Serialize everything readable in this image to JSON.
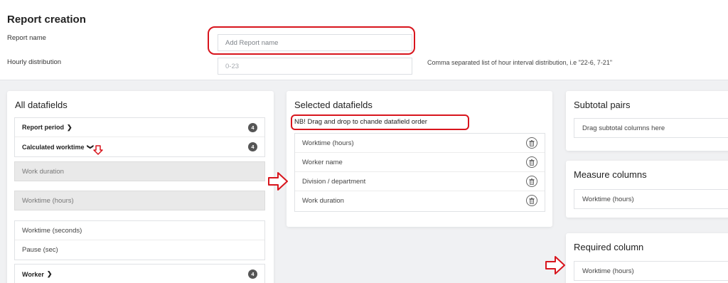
{
  "report_creation": {
    "title": "Report creation",
    "report_name_label": "Report name",
    "report_name_placeholder": "Add Report name",
    "hourly_label": "Hourly distribution",
    "hourly_placeholder": "0-23",
    "hourly_hint": "Comma separated list of hour interval distribution, i.e \"22-6, 7-21\""
  },
  "all_datafields": {
    "title": "All datafields",
    "groups": [
      {
        "label": "Report period",
        "count": "4",
        "chevron": "chevron-right-icon"
      },
      {
        "label": "Calculated worktime",
        "count": "4",
        "chevron": "chevron-down-icon"
      }
    ],
    "disabled_items": [
      "Work duration",
      "Worktime (hours)"
    ],
    "items": [
      "Worktime (seconds)",
      "Pause (sec)"
    ],
    "last_group": {
      "label": "Worker",
      "count": "4",
      "chevron": "chevron-right-icon"
    }
  },
  "selected_datafields": {
    "title": "Selected datafields",
    "note": "NB! Drag and drop to chande datafield order",
    "items": [
      "Worktime (hours)",
      "Worker name",
      "Division / department",
      "Work duration"
    ]
  },
  "subtotal_pairs": {
    "title": "Subtotal pairs",
    "placeholder": "Drag subtotal columns here"
  },
  "measure_columns": {
    "title": "Measure columns",
    "items": [
      "Worktime (hours)"
    ]
  },
  "required_column": {
    "title": "Required column",
    "items": [
      "Worktime (hours)"
    ]
  },
  "colors": {
    "annotation_red": "#d8151d",
    "badge": "#555555",
    "background": "#f0f1f3"
  }
}
